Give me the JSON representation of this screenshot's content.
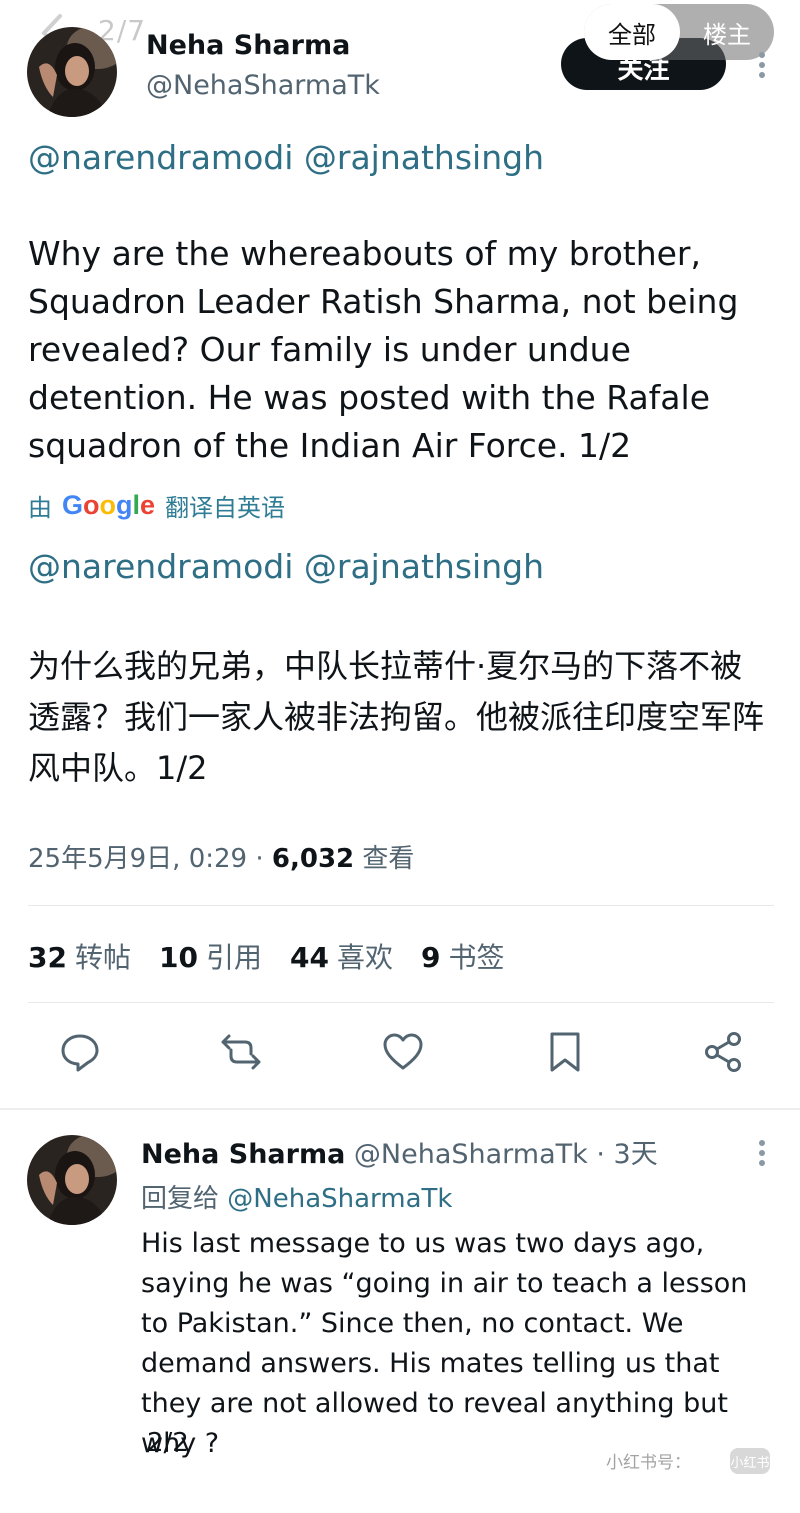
{
  "top_bar": {
    "page_counter": "2/7",
    "segment_all": "全部",
    "segment_op": "楼主",
    "follow_label": "关注"
  },
  "post": {
    "author_name": "Neha Sharma",
    "author_handle": "@NehaSharmaTk",
    "mention_1": "@narendramodi",
    "mention_2": "@rajnathsingh",
    "body_en": "Why are the whereabouts of my brother, Squadron Leader Ratish Sharma, not being revealed? Our family is under undue detention. He was posted with the Rafale squadron of the Indian Air Force. 1/2",
    "translated_prefix": "由",
    "translated_provider": "Google",
    "translated_suffix": "翻译自英语",
    "translated_mention_1": "@narendramodi",
    "translated_mention_2": "@rajnathsingh",
    "body_zh": "为什么我的兄弟，中队长拉蒂什·夏尔马的下落不被透露？我们一家人被非法拘留。他被派往印度空军阵风中队。1/2",
    "timestamp": "25年5月9日, 0:29 · ",
    "views_count": "6,032",
    "views_label": " 查看"
  },
  "stats": [
    {
      "count": "32",
      "label": "转帖"
    },
    {
      "count": "10",
      "label": "引用"
    },
    {
      "count": "44",
      "label": "喜欢"
    },
    {
      "count": "9",
      "label": "书签"
    }
  ],
  "actions": [
    "reply-icon",
    "repost-icon",
    "like-icon",
    "bookmark-icon",
    "share-icon"
  ],
  "reply": {
    "author_name": "Neha Sharma",
    "author_handle": "@NehaSharmaTk",
    "age": " · 3天",
    "reply_prefix": "回复给 ",
    "reply_to": "@NehaSharmaTk",
    "body": "His last message to us was two days ago, saying he was “going in air to teach a lesson to Pakistan.” Since then, no contact. We demand answers. His mates telling us that they are not allowed to reveal anything but why ?",
    "page": "2/2"
  },
  "watermark": {
    "text": "小红书号：",
    "logo": "小红书"
  },
  "colors": {
    "mention": "#2f6f86",
    "secondary_text": "#536471",
    "primary_text": "#0f1419"
  }
}
